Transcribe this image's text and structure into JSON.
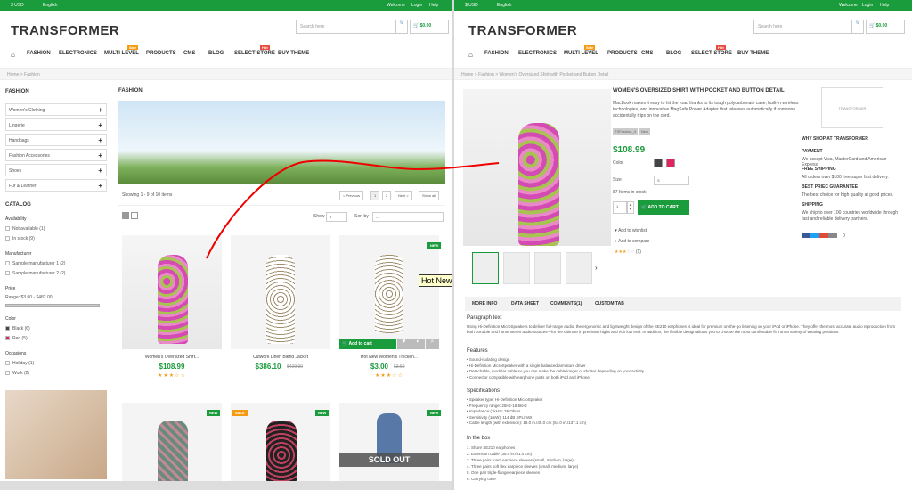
{
  "topbar": {
    "currency": "$ USD",
    "language": "English",
    "welcome": "Welcome",
    "login": "Login",
    "help": "Help"
  },
  "logo": "TRANSFORMER",
  "search": {
    "placeholder": "Search here",
    "button": "Search"
  },
  "cart": {
    "count": "0",
    "total": "$0.00",
    "label": "Cart"
  },
  "nav": {
    "items": [
      "FASHION",
      "ELECTRONICS",
      "MULTI LEVEL",
      "PRODUCTS",
      "CMS",
      "BLOG",
      "SELECT STORE",
      "BUY THEME"
    ],
    "badge_sale": "Sale",
    "badge_hot": "Hot"
  },
  "left": {
    "breadcrumb": "Home > Fashion",
    "sidebar_title": "FASHION",
    "categories": [
      "Women's Clothing",
      "Lingerie",
      "Handbags",
      "Fashion Accessories",
      "Shoes",
      "Fur & Leather"
    ],
    "catalog_title": "CATALOG",
    "availability_title": "Availability",
    "availability": [
      "Not available (1)",
      "In stock (9)"
    ],
    "manufacturer_title": "Manufacturer",
    "manufacturers": [
      "Sample manufacturer 1 (2)",
      "Sample manufacturer 2 (2)"
    ],
    "price_title": "Price",
    "price_range": "Range: $3.00 - $482.00",
    "color_title": "Color",
    "colors": [
      "Black (6)",
      "Red (5)"
    ],
    "occasions_title": "Occasions",
    "occasions": [
      "Holiday (1)",
      "Work (2)"
    ],
    "page_title": "FASHION",
    "showing": "Showing 1 - 9 of 10 items",
    "pager": {
      "prev": "< Previous",
      "p1": "1",
      "p2": "2",
      "next": "Next >",
      "show_all": "Show all"
    },
    "show_label": "Show",
    "show_value": "9",
    "sortby_label": "Sort by",
    "sortby_value": "--",
    "products": [
      {
        "name": "Women's Oversized Shirt...",
        "price": "$108.99",
        "old": "",
        "stars": "★★★☆☆"
      },
      {
        "name": "Cutwork Linen Blend Jacket",
        "price": "$386.10",
        "old": "$429.00",
        "stars": ""
      },
      {
        "name": "Hot New Women's Thicken...",
        "price": "$3.00",
        "old": "$3.50",
        "stars": "★★★☆☆"
      }
    ],
    "add_to_cart": "Add to cart",
    "tooltip": "Hot New",
    "tag_new": "NEW",
    "tag_sale": "SALE",
    "sold_out": "SOLD OUT"
  },
  "right": {
    "breadcrumb": "Home > Fashion > Women's Oversized Shirt with Pocket and Button Detail",
    "title": "WOMEN'S OVERSIZED SHIRT WITH POCKET AND BUTTON DETAIL",
    "short_desc": "MacBook makes it easy to hit the road thanks to its tough polycarbonate case, built-in wireless technologies, and innovative MagSafe Power Adapter that releases automatically if someone accidentally trips on the cord.",
    "tags": [
      "TSFashion_4",
      "New"
    ],
    "price": "$108.99",
    "color_label": "Color",
    "size_label": "Size",
    "size_value": "S",
    "stock": "87 Items in stock",
    "qty": "1",
    "add_to_cart": "ADD TO CART",
    "wishlist": "Add to wishlist",
    "compare": "Add to compare",
    "rating_count": "(1)",
    "brand_logo": "TRANSFORMER",
    "why_title": "WHY SHOP AT TRANSFORMER",
    "why": [
      {
        "h": "PAYMENT",
        "t": "We accept Visa, MasterCard and American Express."
      },
      {
        "h": "FREE SHIPPING",
        "t": "All orders over $100 free super fast delivery."
      },
      {
        "h": "BEST PRIEC GUARANTEE",
        "t": "The best choice for high quality at good prices."
      },
      {
        "h": "SHIPPING",
        "t": "We ship to over 100 countries worldwide through fast and reliable delivery partners."
      }
    ],
    "share_count": "0",
    "tabs": [
      "MORE INFO",
      "DATA SHEET",
      "COMMENTS(1)",
      "CUSTOM TAB"
    ],
    "para_title": "Paragraph text",
    "para": "Using Hi-Definition MicroSpeakers to deliver full-range audio, the ergonomic and lightweight design of the SE210 earphones is ideal for premium on-the-go listening on your iPod or iPhone. They offer the most accurate audio reproduction from both portable and home stereo audio sources—for the ultimate in precision highs and rich low end. In addition, the flexible design allows you to choose the most comfortable fit from a variety of wearing positions.",
    "features_title": "Features",
    "features": [
      "Sound-isolating design",
      "Hi-Definition MicroSpeaker with a single balanced armature driver",
      "Detachable, modular cable so you can make the cable longer or shorter depending on your activity",
      "Connector compatible with earphone ports on both iPod and iPhone"
    ],
    "specs_title": "Specifications",
    "specs": [
      "Speaker type: Hi-Definition MicroSpeaker",
      "Frequency range: 25Hz-18.5kHz",
      "Impedance (1kHz): 26 Ohms",
      "Sensitivity (1mW): 114 dB SPL/mW",
      "Cable length (with extension): 18.0 in./45.0 cm (54.0 in./137.1 cm)"
    ],
    "inbox_title": "In the box",
    "inbox": [
      "1.  Shure SE210 earphones",
      "2.  Extension cable (36.0 in./91.4 cm)",
      "3.  Three pairs foam earpiece sleeves (small, medium, large)",
      "4.  Three pairs soft flex earpiece sleeves (small, medium, large)",
      "5.  One pair triple-flange earpiece sleeves",
      "6.  Carrying case"
    ]
  }
}
